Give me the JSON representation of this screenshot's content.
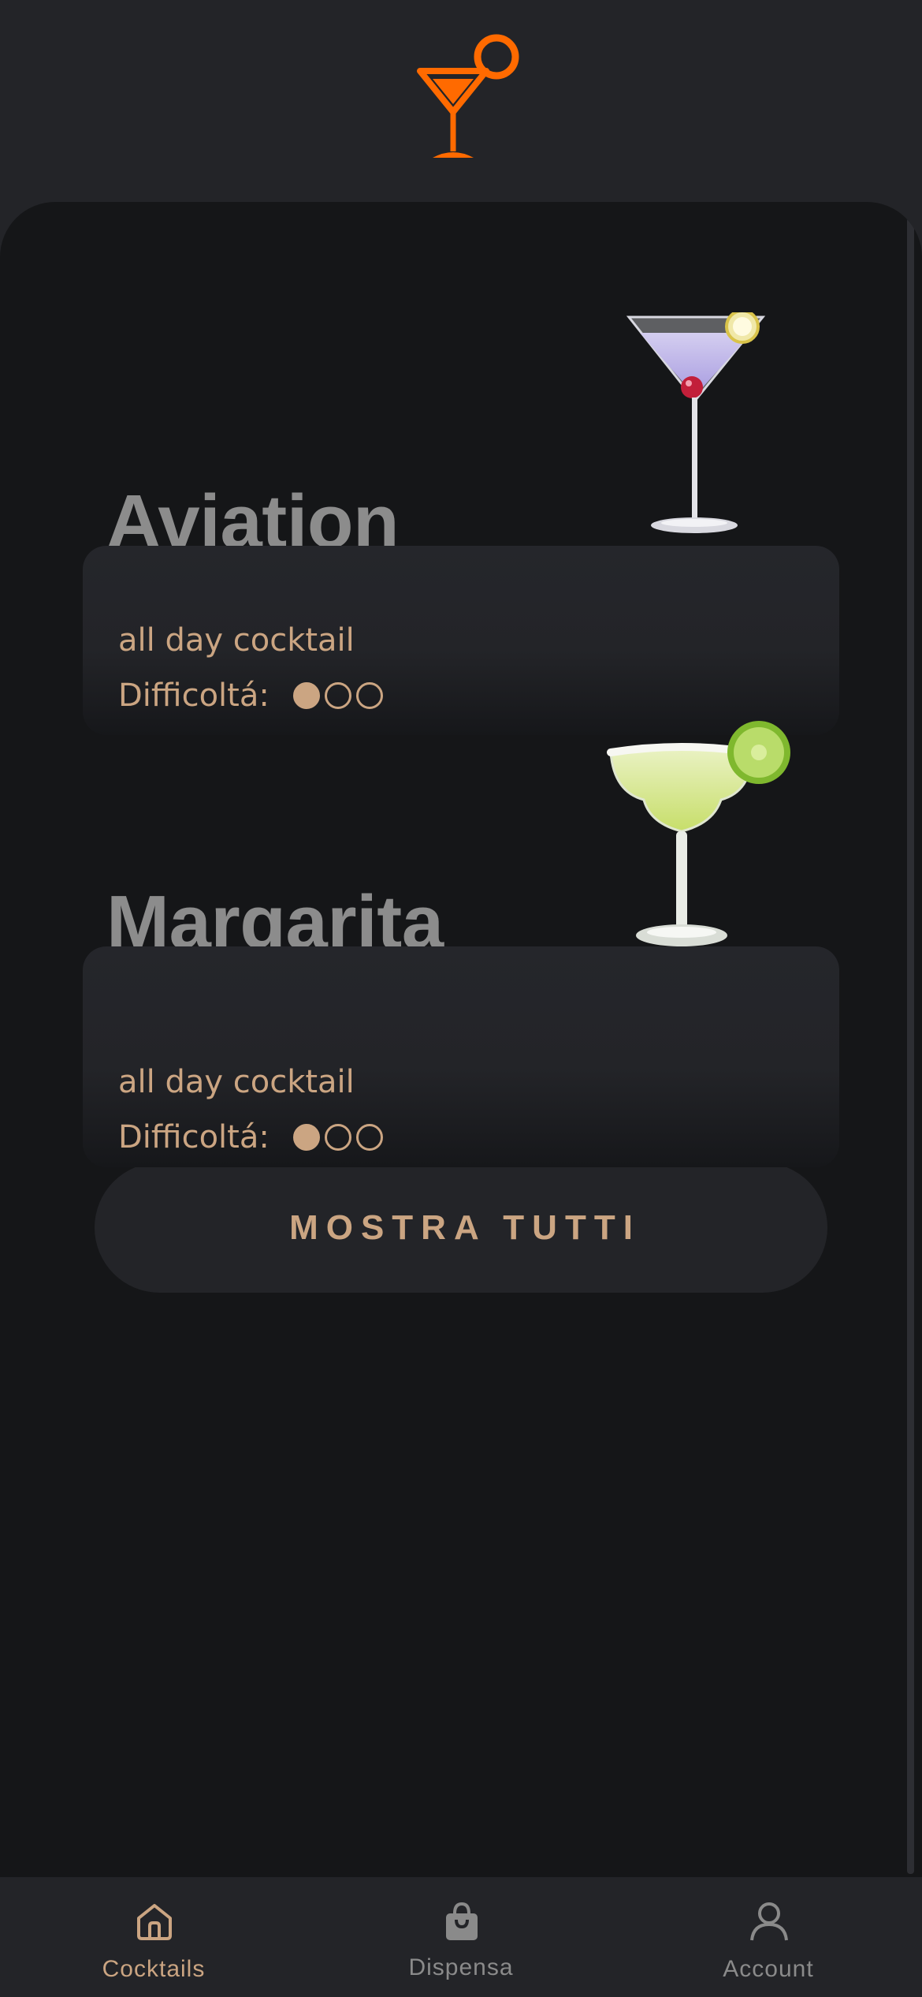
{
  "app": {
    "logo_icon": "cocktail-glass-icon",
    "accent_color": "#ff6a00",
    "text_accent": "#cba582"
  },
  "cocktails": [
    {
      "name": "Aviation",
      "category": "all day cocktail",
      "difficulty_label": "Difficoltá:",
      "difficulty_level": 1,
      "difficulty_max": 3,
      "image": "aviation-martini-glass-image"
    },
    {
      "name": "Margarita",
      "category": "all day cocktail",
      "difficulty_label": "Difficoltá:",
      "difficulty_level": 1,
      "difficulty_max": 3,
      "image": "margarita-glass-image"
    }
  ],
  "show_all_label": "MOSTRA TUTTI",
  "tabbar": {
    "items": [
      {
        "label": "Cocktails",
        "icon": "home-icon",
        "active": true
      },
      {
        "label": "Dispensa",
        "icon": "shopping-bag-icon",
        "active": false
      },
      {
        "label": "Account",
        "icon": "user-icon",
        "active": false
      }
    ]
  }
}
